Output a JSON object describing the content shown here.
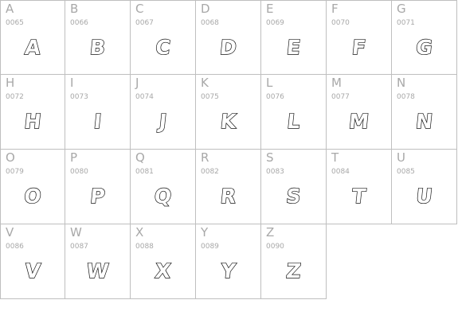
{
  "glyphs": [
    {
      "char": "A",
      "code": "0065"
    },
    {
      "char": "B",
      "code": "0066"
    },
    {
      "char": "C",
      "code": "0067"
    },
    {
      "char": "D",
      "code": "0068"
    },
    {
      "char": "E",
      "code": "0069"
    },
    {
      "char": "F",
      "code": "0070"
    },
    {
      "char": "G",
      "code": "0071"
    },
    {
      "char": "H",
      "code": "0072"
    },
    {
      "char": "I",
      "code": "0073"
    },
    {
      "char": "J",
      "code": "0074"
    },
    {
      "char": "K",
      "code": "0075"
    },
    {
      "char": "L",
      "code": "0076"
    },
    {
      "char": "M",
      "code": "0077"
    },
    {
      "char": "N",
      "code": "0078"
    },
    {
      "char": "O",
      "code": "0079"
    },
    {
      "char": "P",
      "code": "0080"
    },
    {
      "char": "Q",
      "code": "0081"
    },
    {
      "char": "R",
      "code": "0082"
    },
    {
      "char": "S",
      "code": "0083"
    },
    {
      "char": "T",
      "code": "0084"
    },
    {
      "char": "U",
      "code": "0085"
    },
    {
      "char": "V",
      "code": "0086"
    },
    {
      "char": "W",
      "code": "0087"
    },
    {
      "char": "X",
      "code": "0088"
    },
    {
      "char": "Y",
      "code": "0089"
    },
    {
      "char": "Z",
      "code": "0090"
    }
  ]
}
